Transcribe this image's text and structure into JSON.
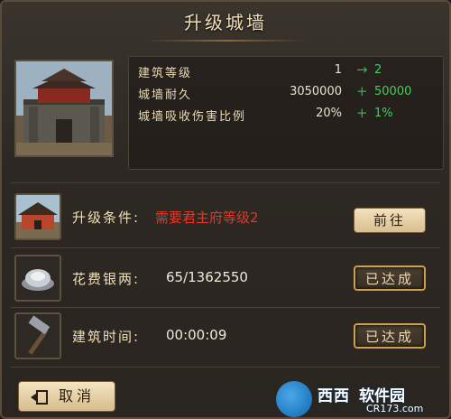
{
  "dialog": {
    "title": "升级城墙"
  },
  "stats": [
    {
      "label": "建筑等级",
      "current": "1",
      "symbol": "→",
      "next": "2"
    },
    {
      "label": "城墙耐久",
      "current": "3050000",
      "symbol": "+",
      "next": "50000"
    },
    {
      "label": "城墙吸收伤害比例",
      "current": "20%",
      "symbol": "+",
      "next": "1%"
    }
  ],
  "requirements": {
    "condition": {
      "label": "升级条件:",
      "value": "需要君主府等级2",
      "button": "前往"
    },
    "silver": {
      "label": "花费银两:",
      "value": "65/1362550",
      "button": "已达成"
    },
    "time": {
      "label": "建筑时间:",
      "value": "00:00:09",
      "button": "已达成"
    }
  },
  "footer": {
    "cancel_label": "取消"
  },
  "watermark": {
    "brand": "西西",
    "name": "软件园",
    "url": "CR173.com"
  },
  "colors": {
    "accent_green": "#3fd05a",
    "warning_red": "#e0392a",
    "gold_border": "#c9a24f"
  }
}
